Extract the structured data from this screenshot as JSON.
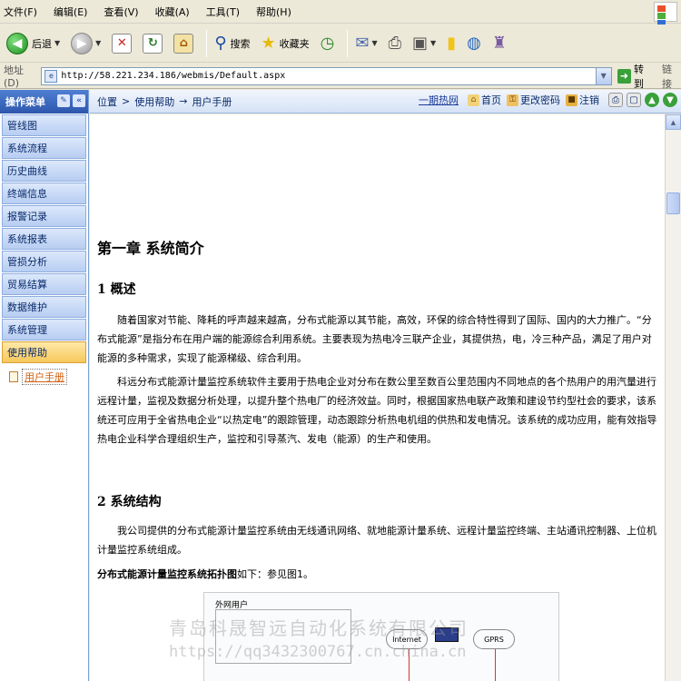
{
  "menu": [
    "文件(F)",
    "编辑(E)",
    "查看(V)",
    "收藏(A)",
    "工具(T)",
    "帮助(H)"
  ],
  "toolbar": {
    "back_label": "后退",
    "search_label": "搜索",
    "favorites_label": "收藏夹"
  },
  "address": {
    "label": "地址(D)",
    "url": "http://58.221.234.186/webmis/Default.aspx",
    "go_label": "转到",
    "links_label": "链接"
  },
  "sidebar": {
    "title": "操作菜单",
    "items": [
      "管线图",
      "系统流程",
      "历史曲线",
      "终端信息",
      "报警记录",
      "系统报表",
      "管损分析",
      "贸易结算",
      "数据维护",
      "系统管理",
      "使用帮助"
    ],
    "active_index": 10,
    "sub_item": "用户手册"
  },
  "nav": {
    "breadcrumb": [
      "位置",
      ">",
      "使用帮助",
      "→",
      "用户手册"
    ],
    "hot_link": "一期热网",
    "home_label": "首页",
    "password_label": "更改密码",
    "logout_label": "注销"
  },
  "doc": {
    "chapter": "第一章  系统简介",
    "section1": "1  概述",
    "para1": "随着国家对节能、降耗的呼声越来越高，分布式能源以其节能，高效，环保的综合特性得到了国际、国内的大力推广。“分布式能源”是指分布在用户端的能源综合利用系统。主要表现为热电冷三联产企业，其提供热，电，冷三种产品，满足了用户对能源的多种需求，实现了能源梯级、综合利用。",
    "para2": "科远分布式能源计量监控系统软件主要用于热电企业对分布在数公里至数百公里范围内不同地点的各个热用户的用汽量进行远程计量，监视及数据分析处理，以提升整个热电厂的经济效益。同时，根据国家热电联产政策和建设节约型社会的要求，该系统还可应用于全省热电企业“以热定电”的跟踪管理，动态跟踪分析热电机组的供热和发电情况。该系统的成功应用，能有效指导热电企业科学合理组织生产，监控和引导蒸汽、发电（能源）的生产和使用。",
    "section2": "2  系统结构",
    "para3": "我公司提供的分布式能源计量监控系统由无线通讯网络、就地能源计量系统、远程计量监控终端、主站通讯控制器、上位机计量监控系统组成。",
    "topology_bold": "分布式能源计量监控系统拓扑图",
    "topology_rest": "如下：参见图1。",
    "diagram_frame": "外网用户",
    "diagram_cloud1": "Internet",
    "diagram_cloud2": "GPRS"
  },
  "watermark": {
    "line1": "青岛科晟智远自动化系统有限公司",
    "line2": "https://qq3432300767.cn.china.cn"
  }
}
